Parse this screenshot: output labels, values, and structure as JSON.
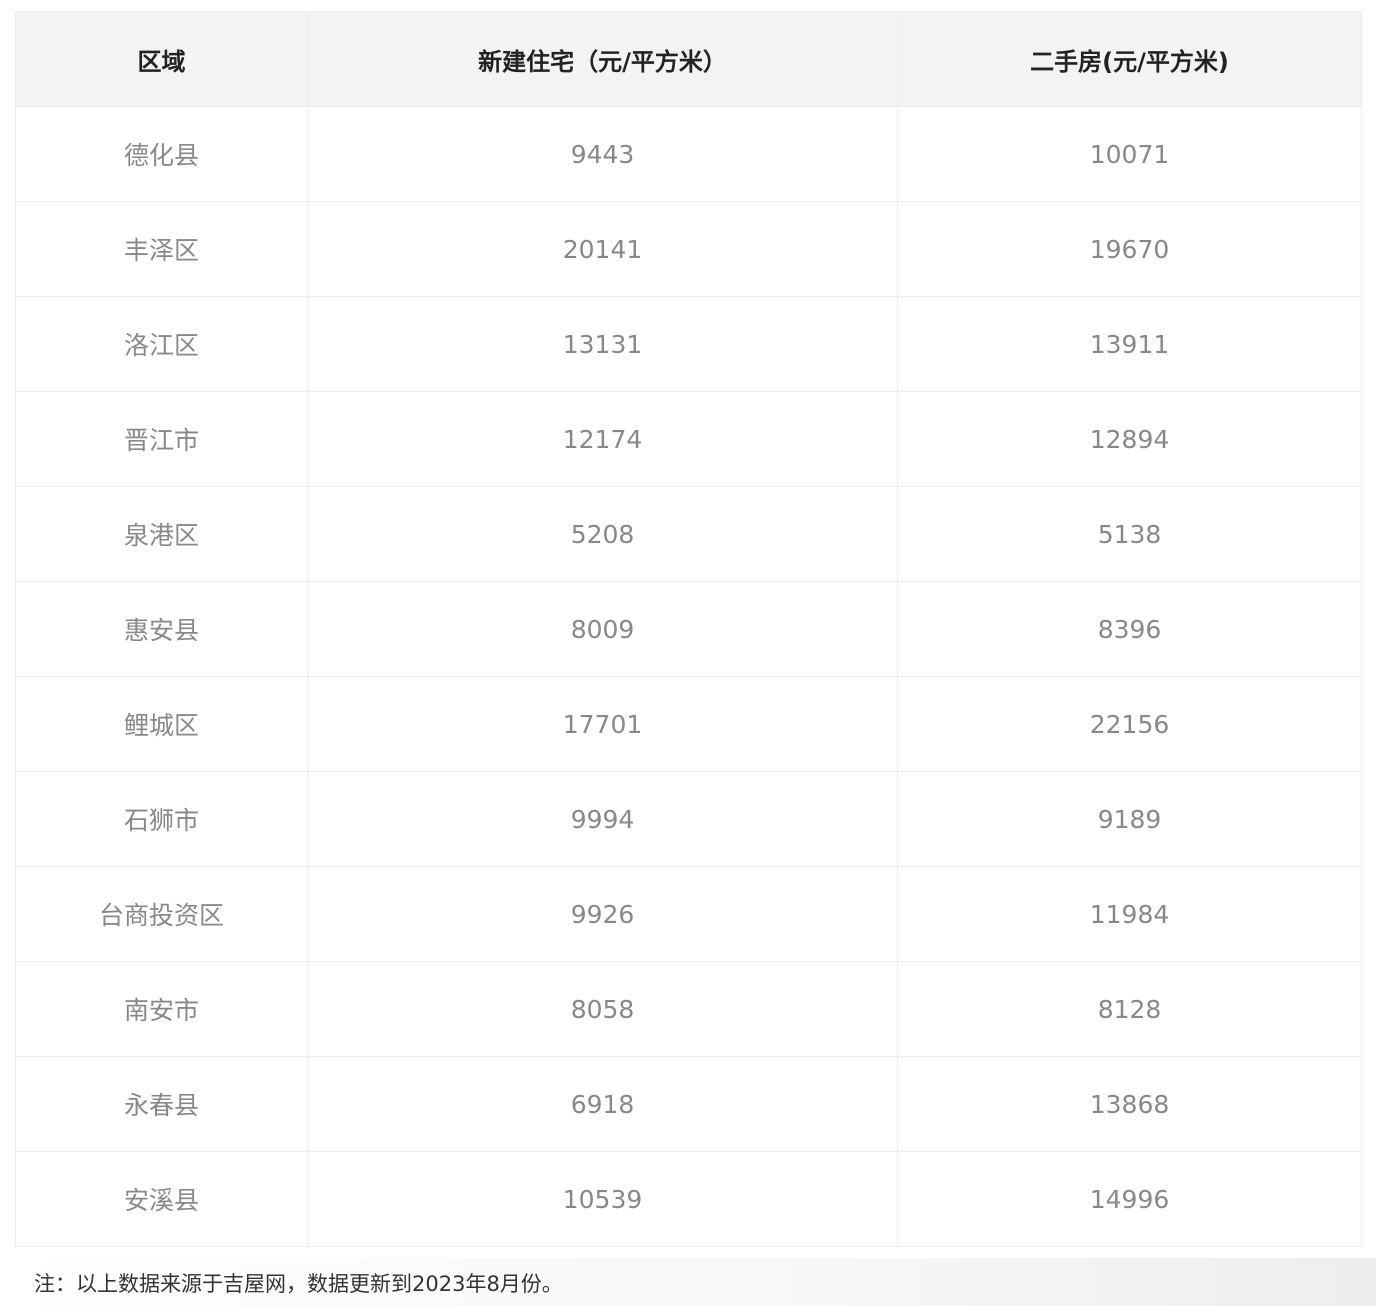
{
  "table": {
    "headers": [
      "区域",
      "新建住宅（元/平方米）",
      "二手房(元/平方米)"
    ],
    "rows": [
      [
        "德化县",
        "9443",
        "10071"
      ],
      [
        "丰泽区",
        "20141",
        "19670"
      ],
      [
        "洛江区",
        "13131",
        "13911"
      ],
      [
        "晋江市",
        "12174",
        "12894"
      ],
      [
        "泉港区",
        "5208",
        "5138"
      ],
      [
        "惠安县",
        "8009",
        "8396"
      ],
      [
        "鲤城区",
        "17701",
        "22156"
      ],
      [
        "石狮市",
        "9994",
        "9189"
      ],
      [
        "台商投资区",
        "9926",
        "11984"
      ],
      [
        "南安市",
        "8058",
        "8128"
      ],
      [
        "永春县",
        "6918",
        "13868"
      ],
      [
        "安溪县",
        "10539",
        "14996"
      ]
    ]
  },
  "footnote": "注：以上数据来源于吉屋网，数据更新到2023年8月份。"
}
